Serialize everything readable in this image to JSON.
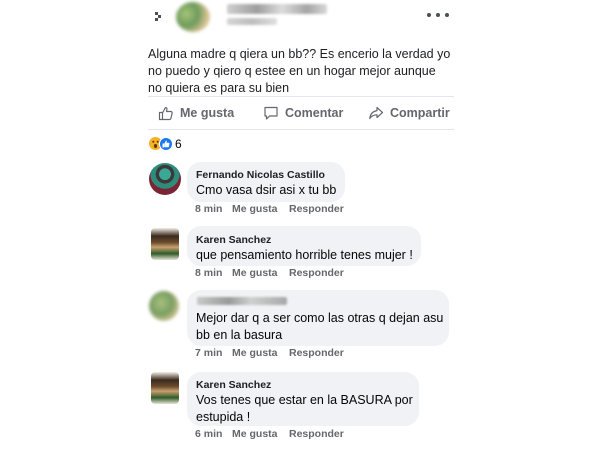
{
  "post": {
    "author_avatar_colors": [
      "#9ab86a",
      "#c9b27a",
      "#6d9c5a",
      "#e3d7b8"
    ],
    "text": "Alguna madre q qiera un bb?? Es encerio la verdad yo no puedo y qiero q estee en un hogar mejor aunque no quiera es para su bien"
  },
  "actions": {
    "like": "Me gusta",
    "comment": "Comentar",
    "share": "Compartir"
  },
  "reactions": {
    "count": "6",
    "types": [
      "wow",
      "like"
    ],
    "colors": {
      "wow": "#f7b125",
      "like": "#1877f2"
    }
  },
  "comments": [
    {
      "author": "Fernando Nicolas Castillo",
      "text": "Cmo vasa dsir asi x tu bb",
      "time": "8 min",
      "like": "Me gusta",
      "reply": "Responder"
    },
    {
      "author": "Karen Sanchez",
      "text": "que pensamiento horrible tenes mujer !",
      "time": "8 min",
      "like": "Me gusta",
      "reply": "Responder"
    },
    {
      "author": "",
      "text": "Mejor dar q a ser como las otras q dejan asu bb en la basura",
      "time": "7 min",
      "like": "Me gusta",
      "reply": "Responder"
    },
    {
      "author": "Karen Sanchez",
      "text": "Vos tenes que estar en la BASURA por estupida !",
      "time": "6 min",
      "like": "Me gusta",
      "reply": "Responder"
    }
  ],
  "colors": {
    "bubble": "#f0f2f5",
    "meta": "#65676b",
    "divider": "#e4e6eb"
  }
}
